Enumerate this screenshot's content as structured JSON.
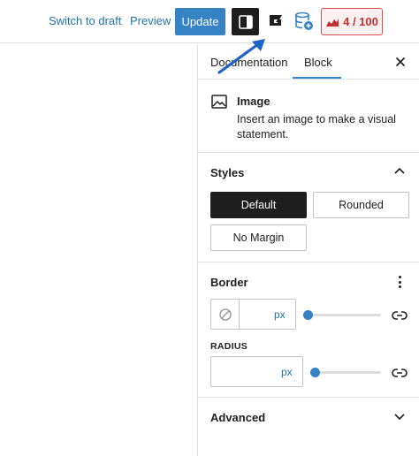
{
  "toolbar": {
    "switch_to_draft": "Switch to draft",
    "preview": "Preview",
    "update": "Update",
    "score": "4 / 100",
    "icons": {
      "sidebar_toggle": "sidebar-toggle-icon",
      "plugin": "g-plugin-icon",
      "database": "database-add-icon",
      "score": "seo-score-icon"
    }
  },
  "sidebar": {
    "tabs": [
      "Documentation",
      "Block"
    ],
    "active_tab": "Block",
    "block": {
      "name": "Image",
      "description": "Insert an image to make a visual statement."
    },
    "styles": {
      "title": "Styles",
      "options": [
        "Default",
        "Rounded",
        "No Margin"
      ],
      "selected": "Default"
    },
    "border": {
      "title": "Border",
      "width_unit": "px",
      "radius_label": "RADIUS",
      "radius_unit": "px",
      "width_slider_fraction": 0,
      "radius_slider_fraction": 0
    },
    "advanced": {
      "title": "Advanced"
    }
  },
  "colors": {
    "accent": "#3582c4",
    "link": "#2271b1",
    "score_red": "#c62f2f",
    "dark": "#1e1e1e"
  }
}
